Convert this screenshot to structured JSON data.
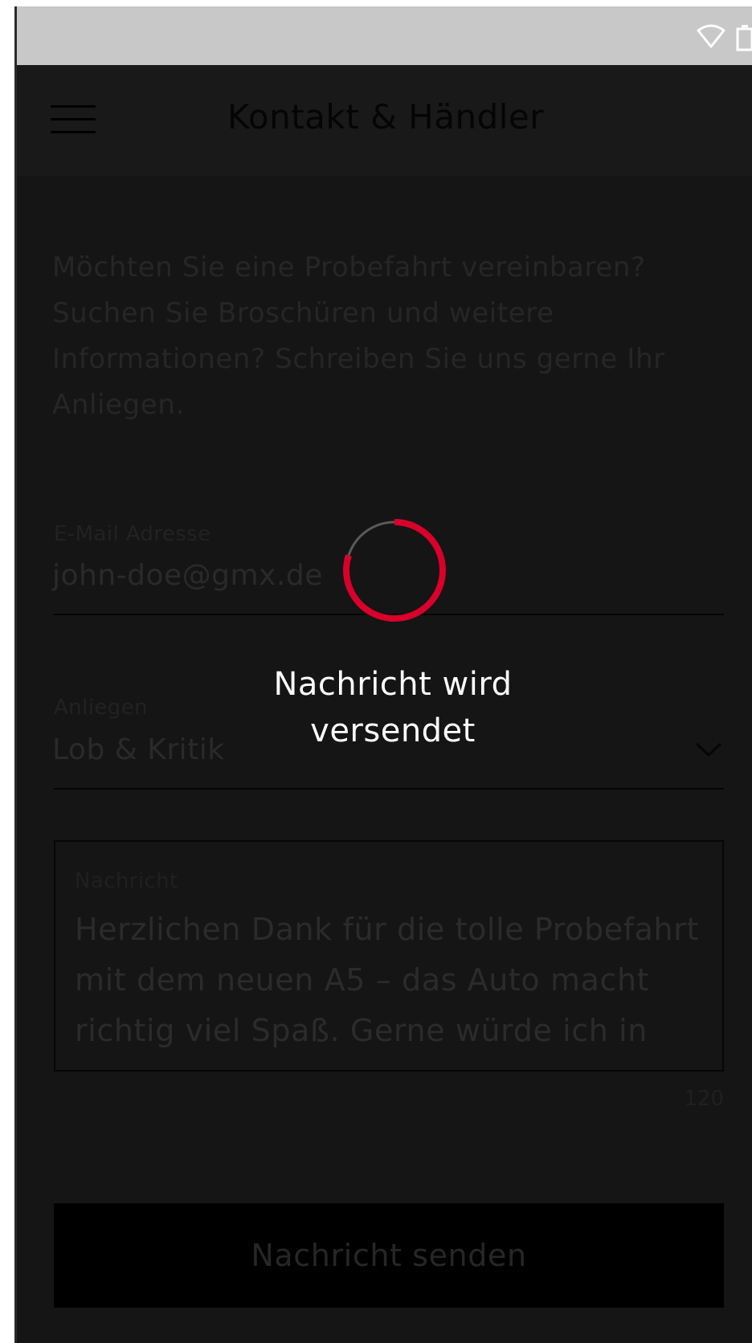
{
  "header": {
    "title": "Kontakt & Händler"
  },
  "intro": {
    "text": "Möchten Sie eine Probefahrt vereinbaren? Suchen Sie Broschüren und weitere Informationen? Schreiben Sie uns gerne Ihr Anliegen."
  },
  "form": {
    "email": {
      "label": "E-Mail Adresse",
      "value": "john-doe@gmx.de"
    },
    "subject": {
      "label": "Anliegen",
      "value": "Lob & Kritik"
    },
    "message": {
      "label": "Nachricht",
      "value": "Herzlichen Dank für die tolle Probefahrt mit dem neuen A5 – das Auto macht richtig viel Spaß. Gerne würde ich in",
      "char_count": "120"
    },
    "submit_label": "Nachricht senden"
  },
  "loading": {
    "message": "Nachricht wird versendet",
    "progress": 0.8
  },
  "colors": {
    "accent": "#d8002a",
    "background": "#151515",
    "statusbar": "#c8c8c8"
  },
  "icons": {
    "status": [
      "wifi-icon",
      "battery-icon"
    ],
    "menu": "hamburger-menu-icon",
    "dropdown": "chevron-down-icon"
  }
}
